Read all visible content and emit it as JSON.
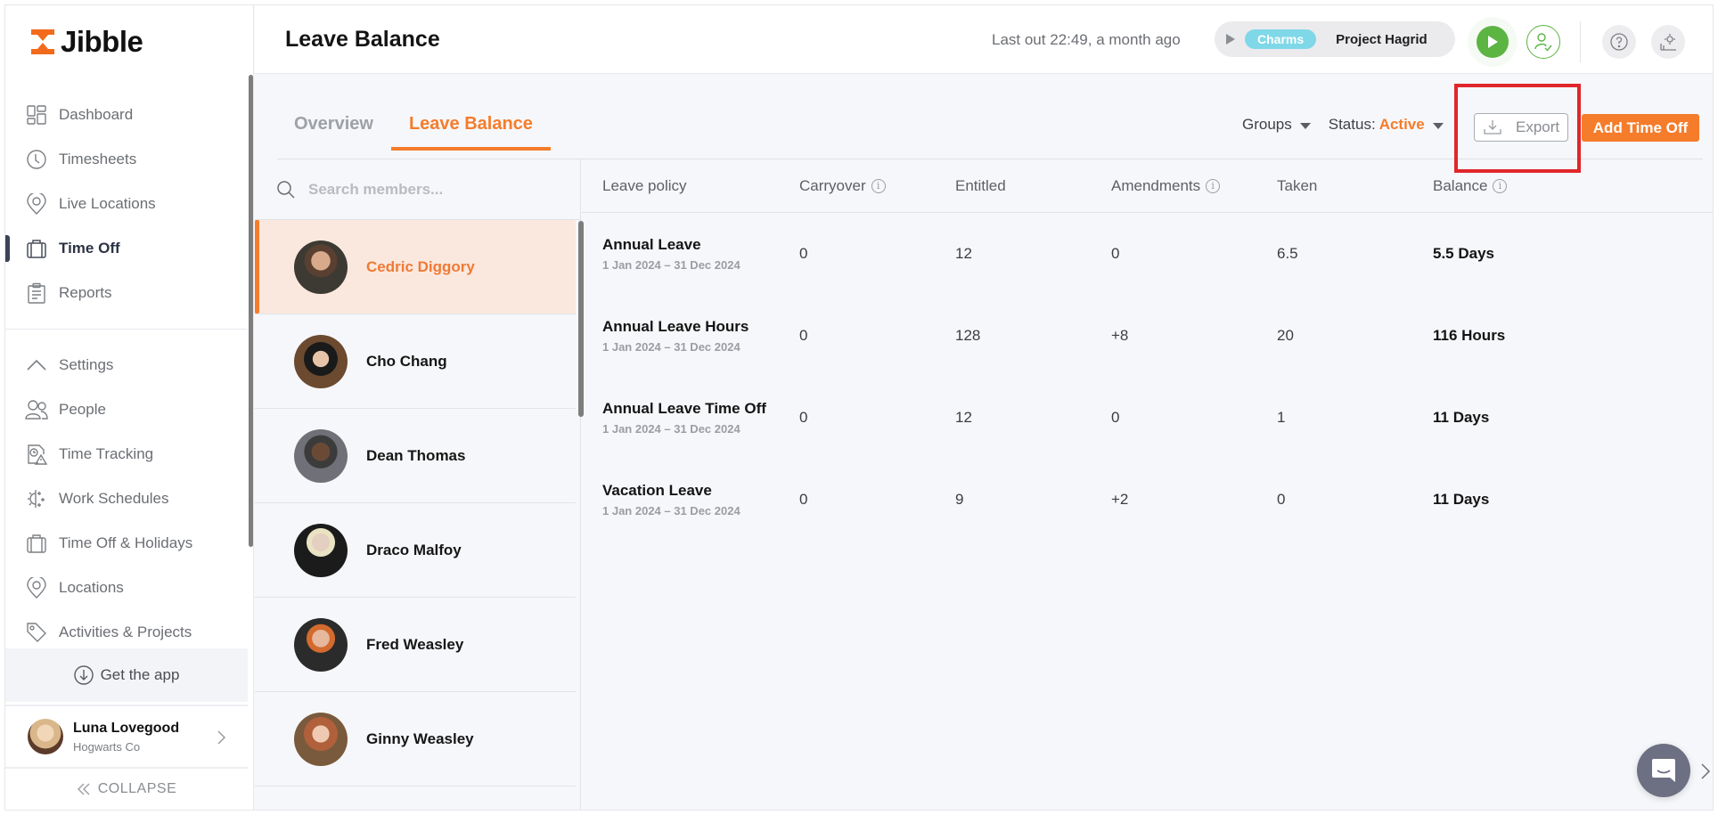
{
  "app": {
    "brand": "Jibble"
  },
  "sidebar": {
    "items": [
      {
        "label": "Dashboard",
        "icon": "dashboard-icon"
      },
      {
        "label": "Timesheets",
        "icon": "clock-icon"
      },
      {
        "label": "Live Locations",
        "icon": "location-pin-icon"
      },
      {
        "label": "Time Off",
        "icon": "briefcase-icon",
        "active": true
      },
      {
        "label": "Reports",
        "icon": "clipboard-icon"
      }
    ],
    "settings_items": [
      {
        "label": "Settings",
        "icon": "chevron-up-icon"
      },
      {
        "label": "People",
        "icon": "people-icon"
      },
      {
        "label": "Time Tracking",
        "icon": "time-tracking-icon"
      },
      {
        "label": "Work Schedules",
        "icon": "work-schedules-icon"
      },
      {
        "label": "Time Off & Holidays",
        "icon": "briefcase-icon"
      },
      {
        "label": "Locations",
        "icon": "location-pin-icon"
      },
      {
        "label": "Activities & Projects",
        "icon": "tag-icon"
      }
    ],
    "get_app": "Get the app",
    "user": {
      "name": "Luna Lovegood",
      "org": "Hogwarts Co"
    },
    "collapse": "COLLAPSE"
  },
  "header": {
    "title": "Leave Balance",
    "last_out": "Last out 22:49, a month ago",
    "activity": "Charms",
    "project": "Project Hagrid"
  },
  "tabs": [
    {
      "label": "Overview",
      "active": false
    },
    {
      "label": "Leave Balance",
      "active": true
    }
  ],
  "filters": {
    "groups": "Groups",
    "status_label": "Status",
    "status_value": "Active",
    "export": "Export",
    "add_time_off": "Add Time Off"
  },
  "search": {
    "placeholder": "Search members..."
  },
  "members": [
    {
      "name": "Cedric Diggory",
      "selected": true
    },
    {
      "name": "Cho Chang"
    },
    {
      "name": "Dean Thomas"
    },
    {
      "name": "Draco Malfoy"
    },
    {
      "name": "Fred Weasley"
    },
    {
      "name": "Ginny Weasley"
    }
  ],
  "table": {
    "headers": [
      "Leave policy",
      "Carryover",
      "Entitled",
      "Amendments",
      "Taken",
      "Balance"
    ],
    "rows": [
      {
        "policy": "Annual Leave",
        "range": "1 Jan 2024 – 31 Dec 2024",
        "carryover": "0",
        "entitled": "12",
        "amendments": "0",
        "taken": "6.5",
        "balance": "5.5 Days"
      },
      {
        "policy": "Annual Leave Hours",
        "range": "1 Jan 2024 – 31 Dec 2024",
        "carryover": "0",
        "entitled": "128",
        "amendments": "+8",
        "taken": "20",
        "balance": "116 Hours"
      },
      {
        "policy": "Annual Leave Time Off",
        "range": "1 Jan 2024 – 31 Dec 2024",
        "carryover": "0",
        "entitled": "12",
        "amendments": "0",
        "taken": "1",
        "balance": "11 Days"
      },
      {
        "policy": "Vacation Leave",
        "range": "1 Jan 2024 – 31 Dec 2024",
        "carryover": "0",
        "entitled": "9",
        "amendments": "+2",
        "taken": "0",
        "balance": "11 Days"
      }
    ]
  },
  "colors": {
    "accent": "#f57c2b",
    "play": "#5cb443",
    "activity": "#7fd8e8",
    "highlight": "#e0262b"
  }
}
